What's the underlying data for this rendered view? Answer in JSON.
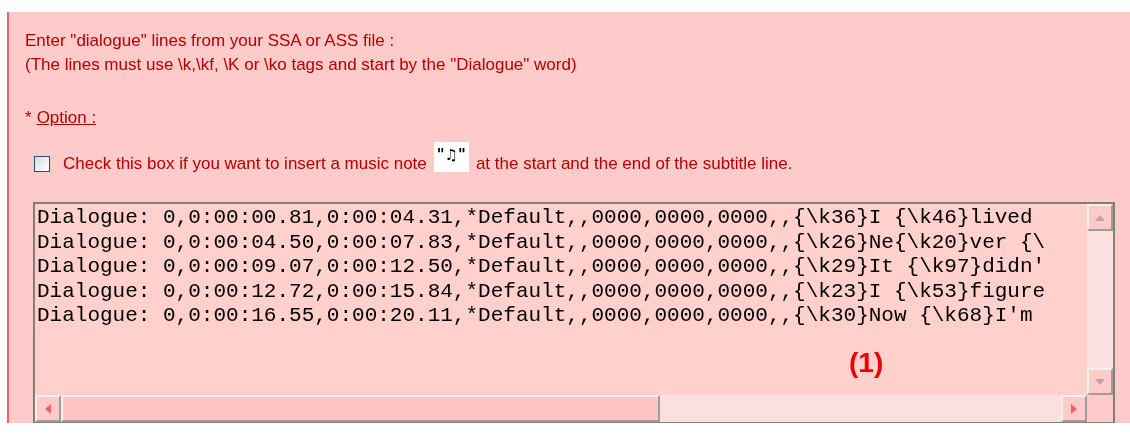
{
  "instructions": [
    "Enter \"dialogue\" lines from your SSA or ASS file :",
    "(The lines must use \\k,\\kf, \\K or \\ko tags and start by the \"Dialogue\" word)"
  ],
  "option": {
    "bullet": "*",
    "label": "Option :"
  },
  "checkbox": {
    "checked": false,
    "label_before": "Check this box if you want to insert a music note",
    "note": "\"♫\"",
    "label_after": "at the start and the end of the subtitle line."
  },
  "lines": [
    "Dialogue: 0,0:00:00.81,0:00:04.31,*Default,,0000,0000,0000,,{\\k36}I {\\k46}lived",
    "Dialogue: 0,0:00:04.50,0:00:07.83,*Default,,0000,0000,0000,,{\\k26}Ne{\\k20}ver {\\",
    "Dialogue: 0,0:00:09.07,0:00:12.50,*Default,,0000,0000,0000,,{\\k29}It {\\k97}didn'",
    "Dialogue: 0,0:00:12.72,0:00:15.84,*Default,,0000,0000,0000,,{\\k23}I {\\k53}figure",
    "Dialogue: 0,0:00:16.55,0:00:20.11,*Default,,0000,0000,0000,,{\\k30}Now {\\k68}I'm"
  ],
  "annotation": "(1)"
}
